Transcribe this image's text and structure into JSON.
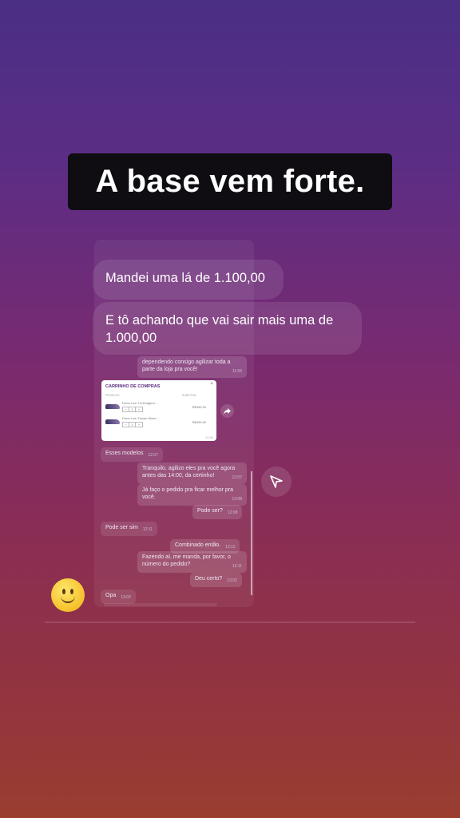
{
  "story": {
    "caption": "A base vem forte."
  },
  "large_messages": [
    {
      "text": "Mandei uma lá de 1.100,00"
    },
    {
      "text": "E tô achando que vai sair mais uma de 1.000,00"
    }
  ],
  "chat": {
    "messages": [
      {
        "text": "dependendo consigo agilizar toda a parte da loja pra você!",
        "time": "11:55"
      },
      {
        "text": "Esses modelos",
        "time": "12:07"
      },
      {
        "text": "Tranquilo, agilizo eles pra você agora antes das 14:00, da certinho!",
        "time": "12:07"
      },
      {
        "text": "Já faço o pedido pra ficar melhor pra você.",
        "time": "12:08"
      },
      {
        "text": "Pode ser?",
        "time": "12:08"
      },
      {
        "text": "Pode ser sim",
        "time": "12:11"
      },
      {
        "text": "Combinado então.",
        "time": "12:11"
      },
      {
        "text": "Fazendo aí, me manda, por favor, o número do pedido?",
        "time": "12:11"
      },
      {
        "text": "Deu certo?",
        "time": "13:02"
      },
      {
        "text": "Opa",
        "time": "13:03"
      }
    ],
    "cart": {
      "title": "CARRINHO DE COMPRAS",
      "col_product": "PRODUTO",
      "col_subtotal": "SUBTOTAL",
      "items": [
        {
          "name": "Duna Low 'LA Dodgers' ..",
          "price": "R$499,90",
          "qty": "1"
        },
        {
          "name": "Duna Low 'Cacau Wave'...",
          "price": "R$499,90",
          "qty": "1"
        }
      ],
      "time": "12:06"
    }
  },
  "icons": {
    "send": "send-icon",
    "share": "share-icon",
    "emoji": "smiley-emoji-icon"
  }
}
